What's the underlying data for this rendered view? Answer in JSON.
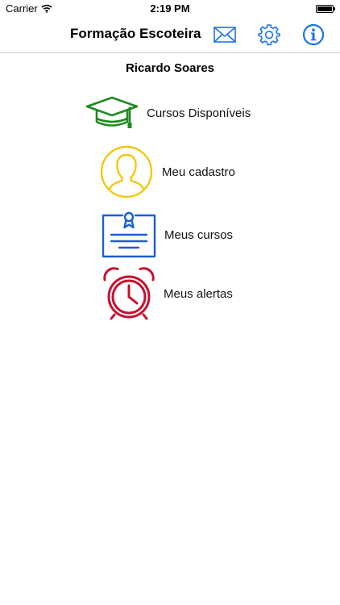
{
  "status_bar": {
    "carrier": "Carrier",
    "time": "2:19 PM"
  },
  "nav": {
    "title": "Formação Escoteira",
    "icons": [
      "mail-icon",
      "gear-icon",
      "info-icon"
    ],
    "accent_color": "#1a73e8"
  },
  "user": {
    "name": "Ricardo Soares"
  },
  "menu": {
    "items": [
      {
        "label": "Cursos Disponíveis",
        "icon": "graduation-cap-icon",
        "color": "#1f8a1f"
      },
      {
        "label": "Meu cadastro",
        "icon": "profile-icon",
        "color": "#f2c811"
      },
      {
        "label": "Meus cursos",
        "icon": "certificate-icon",
        "color": "#1a5fd0"
      },
      {
        "label": "Meus alertas",
        "icon": "alarm-clock-icon",
        "color": "#c8102e"
      }
    ]
  }
}
